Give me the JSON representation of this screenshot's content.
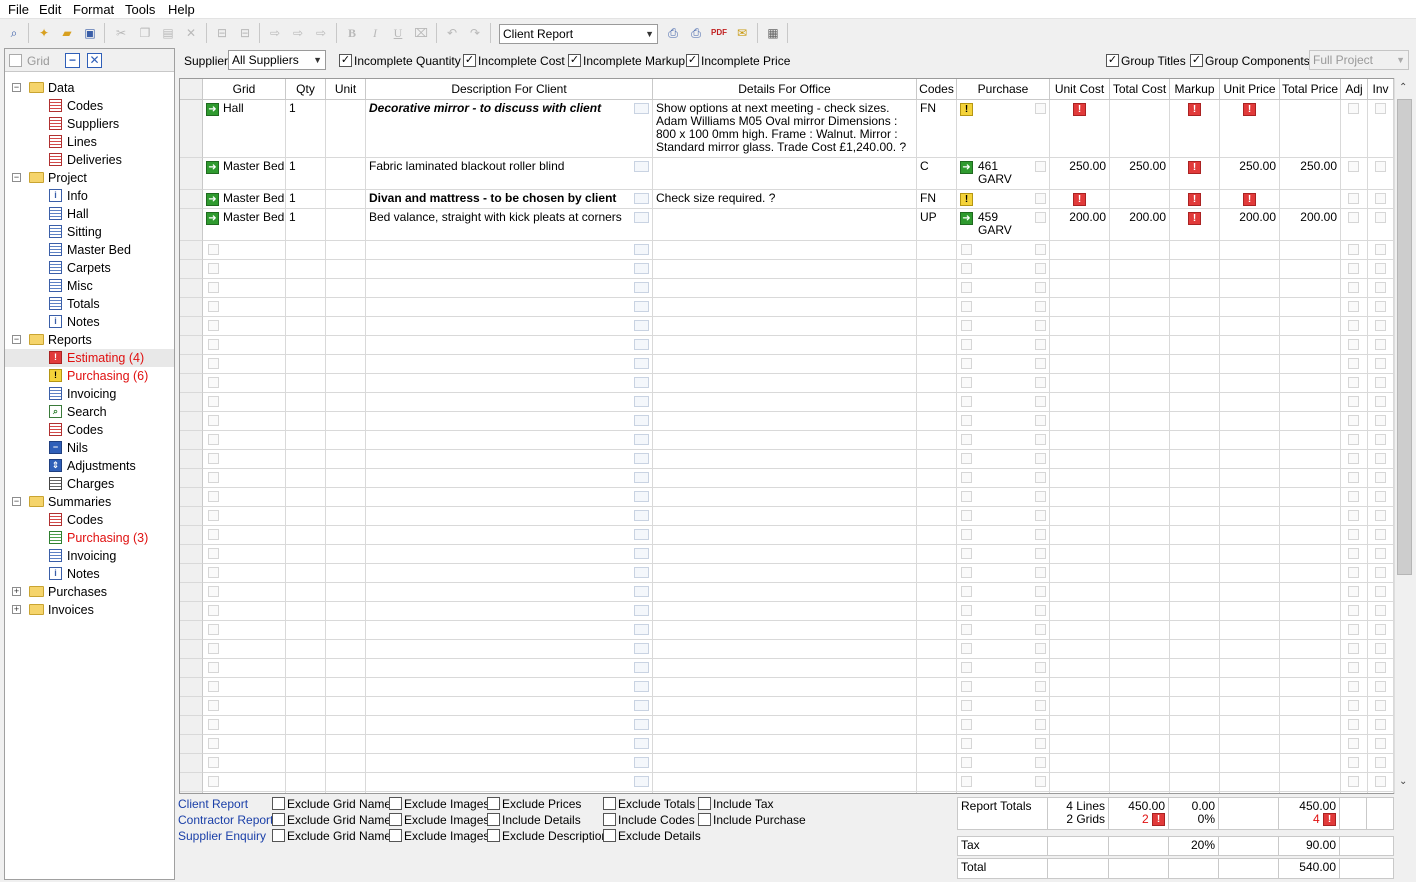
{
  "menu": [
    "File",
    "Edit",
    "Format",
    "Tools",
    "Help"
  ],
  "toolbar": {
    "report_select": "Client Report"
  },
  "left_panel": {
    "grid_label": "Grid",
    "tree": [
      {
        "label": "Data",
        "level": 0,
        "type": "folder",
        "expander": "−"
      },
      {
        "label": "Codes",
        "level": 1,
        "icon": "grid"
      },
      {
        "label": "Suppliers",
        "level": 1,
        "icon": "grid"
      },
      {
        "label": "Lines",
        "level": 1,
        "icon": "grid"
      },
      {
        "label": "Deliveries",
        "level": 1,
        "icon": "grid"
      },
      {
        "label": "Project",
        "level": 0,
        "type": "folder",
        "expander": "−"
      },
      {
        "label": "Info",
        "level": 1,
        "icon": "info"
      },
      {
        "label": "Hall",
        "level": 1,
        "icon": "sheet"
      },
      {
        "label": "Sitting",
        "level": 1,
        "icon": "sheet"
      },
      {
        "label": "Master Bed",
        "level": 1,
        "icon": "sheet"
      },
      {
        "label": "Carpets",
        "level": 1,
        "icon": "sheet"
      },
      {
        "label": "Misc",
        "level": 1,
        "icon": "sheet"
      },
      {
        "label": "Totals",
        "level": 1,
        "icon": "sheet"
      },
      {
        "label": "Notes",
        "level": 1,
        "icon": "info"
      },
      {
        "label": "Reports",
        "level": 0,
        "type": "folder",
        "expander": "−"
      },
      {
        "label": "Estimating (4)",
        "level": 1,
        "icon": "err",
        "red": true,
        "selected": true
      },
      {
        "label": "Purchasing (6)",
        "level": 1,
        "icon": "warn",
        "red": true
      },
      {
        "label": "Invoicing",
        "level": 1,
        "icon": "sheet"
      },
      {
        "label": "Search",
        "level": 1,
        "icon": "srch"
      },
      {
        "label": "Codes",
        "level": 1,
        "icon": "grid"
      },
      {
        "label": "Nils",
        "level": 1,
        "icon": "nil"
      },
      {
        "label": "Adjustments",
        "level": 1,
        "icon": "adj"
      },
      {
        "label": "Charges",
        "level": 1,
        "icon": "chg"
      },
      {
        "label": "Summaries",
        "level": 0,
        "type": "folder",
        "expander": "−"
      },
      {
        "label": "Codes",
        "level": 1,
        "icon": "grid"
      },
      {
        "label": "Purchasing (3)",
        "level": 1,
        "icon": "green",
        "red": true
      },
      {
        "label": "Invoicing",
        "level": 1,
        "icon": "sheet"
      },
      {
        "label": "Notes",
        "level": 1,
        "icon": "info"
      },
      {
        "label": "Purchases",
        "level": 0,
        "type": "folder",
        "expander": "+"
      },
      {
        "label": "Invoices",
        "level": 0,
        "type": "folder",
        "expander": "+"
      }
    ]
  },
  "filter": {
    "supplier_label": "Supplier",
    "supplier_value": "All Suppliers",
    "checks": [
      "Incomplete Quantity",
      "Incomplete Cost",
      "Incomplete Markup",
      "Incomplete Price"
    ],
    "right_checks": [
      "Group Titles",
      "Group Components"
    ],
    "scope": "Full Project"
  },
  "grid": {
    "columns": [
      "",
      "Grid",
      "Qty",
      "Unit",
      "Description For Client",
      "Details For Office",
      "Codes",
      "Purchase",
      "Unit Cost",
      "Total Cost",
      "Markup",
      "Unit Price",
      "Total Price",
      "Adj",
      "Inv"
    ],
    "rows": [
      {
        "grid": "Hall",
        "qty": "1",
        "unit": "",
        "desc": "Decorative mirror - to discuss with client",
        "desc_style": "bi",
        "details": "Show options at next meeting - check sizes. Adam Williams M05 Oval mirror Dimensions : 800 x 100 0mm high. Frame : Walnut. Mirror : Standard mirror glass. Trade Cost £1,240.00. ?",
        "codes": "FN",
        "purchase": "warn",
        "purchase_text": "",
        "unit_cost": "err",
        "total_cost": "",
        "markup": "err",
        "unit_price": "err",
        "total_price": ""
      },
      {
        "grid": "Master Bed",
        "qty": "1",
        "unit": "",
        "desc": "Fabric laminated blackout roller blind",
        "desc_style": "",
        "details": "",
        "codes": "C",
        "purchase": "green",
        "purchase_text": "461\nGARV",
        "unit_cost": "250.00",
        "total_cost": "250.00",
        "markup": "err",
        "unit_price": "250.00",
        "total_price": "250.00"
      },
      {
        "grid": "Master Bed",
        "qty": "1",
        "unit": "",
        "desc": "Divan and mattress - to be chosen by client",
        "desc_style": "b",
        "details": "Check size required. ?",
        "codes": "FN",
        "purchase": "warn",
        "purchase_text": "",
        "unit_cost": "err",
        "total_cost": "",
        "markup": "err",
        "unit_price": "err",
        "total_price": ""
      },
      {
        "grid": "Master Bed",
        "qty": "1",
        "unit": "",
        "desc": "Bed valance, straight with kick pleats at corners",
        "desc_style": "",
        "details": "",
        "codes": "UP",
        "purchase": "green",
        "purchase_text": "459\nGARV",
        "unit_cost": "200.00",
        "total_cost": "200.00",
        "markup": "err",
        "unit_price": "200.00",
        "total_price": "200.00"
      }
    ]
  },
  "bottom": {
    "links": [
      "Client Report",
      "Contractor Report",
      "Supplier Enquiry"
    ],
    "options": [
      [
        "Exclude Grid Names",
        "Exclude Images",
        "Exclude Prices",
        "Exclude Totals",
        "Include Tax"
      ],
      [
        "Exclude Grid Names",
        "Exclude Images",
        "Include Details",
        "Include Codes",
        "Include Purchase"
      ],
      [
        "Exclude Grid Names",
        "Exclude Images",
        "Exclude Description",
        "Exclude Details"
      ]
    ],
    "totals": {
      "label": "Report Totals",
      "lines": "4 Lines",
      "grids": "2 Grids",
      "total_cost": "450.00",
      "cost_errors": "2",
      "markup": "0.00",
      "markup_pct": "0%",
      "total_price": "450.00",
      "price_errors": "4",
      "tax_label": "Tax",
      "tax_pct": "20%",
      "tax_value": "90.00",
      "total_label": "Total",
      "total_value": "540.00"
    }
  }
}
